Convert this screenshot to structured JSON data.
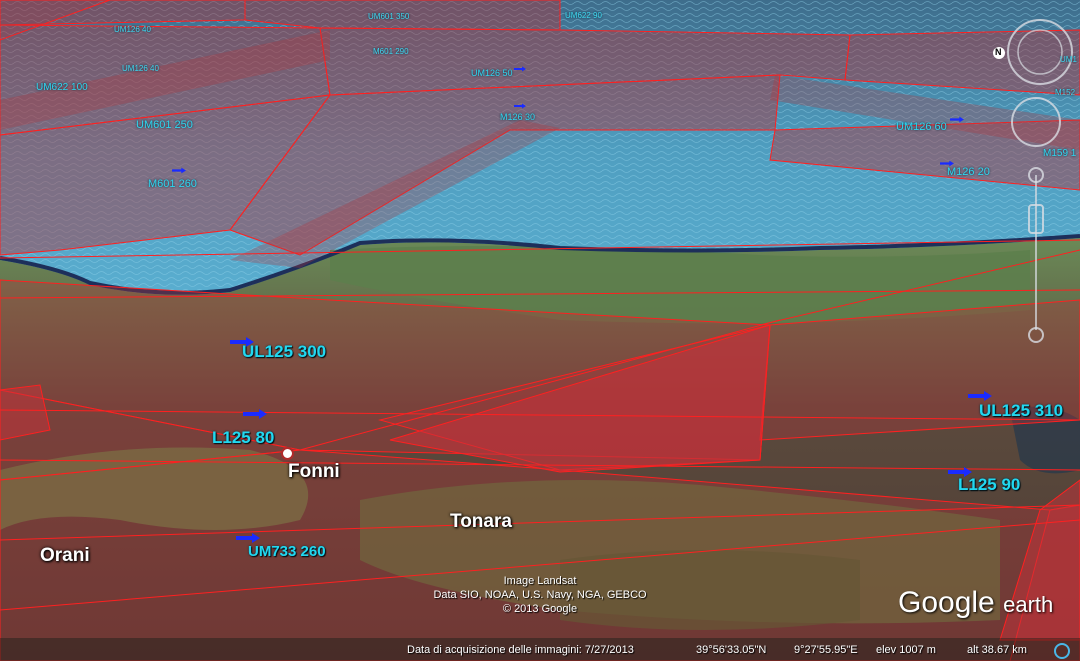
{
  "map": {
    "towns": [
      "Fonni",
      "Tonara",
      "Orani"
    ],
    "airways_large": [
      "UL125 300",
      "L125 80",
      "UM733 260",
      "UL125 310",
      "L125 90"
    ],
    "airways_medium": [
      "UM601 250",
      "M601 260",
      "UM622 100",
      "UM126 50",
      "M126 30",
      "UM126 60",
      "M126 20",
      "M159 1"
    ],
    "airways_small": [
      "UM126 40",
      "UM126 40",
      "UM601 350",
      "UM622 90",
      "M601 290",
      "UM1",
      "M152"
    ],
    "compass_letter": "N",
    "attribution": [
      "Image Landsat",
      "Data SIO, NOAA, U.S. Navy, NGA, GEBCO",
      "© 2013 Google"
    ],
    "logo": {
      "google": "Google",
      "earth": "earth"
    },
    "colors": {
      "airspace_fill": "#b2343a",
      "airspace_line": "#ff2020",
      "sea": "#4f9ec0",
      "airway_label": "#22d8f0",
      "arrow": "#1a2bff"
    }
  },
  "statusbar": {
    "acquisition": "Data di acquisizione delle immagini: 7/27/2013",
    "lat": "39°56'33.05\"N",
    "lon": "9°27'55.95\"E",
    "elev": "elev  1007 m",
    "alt": "alt  38.67 km"
  }
}
